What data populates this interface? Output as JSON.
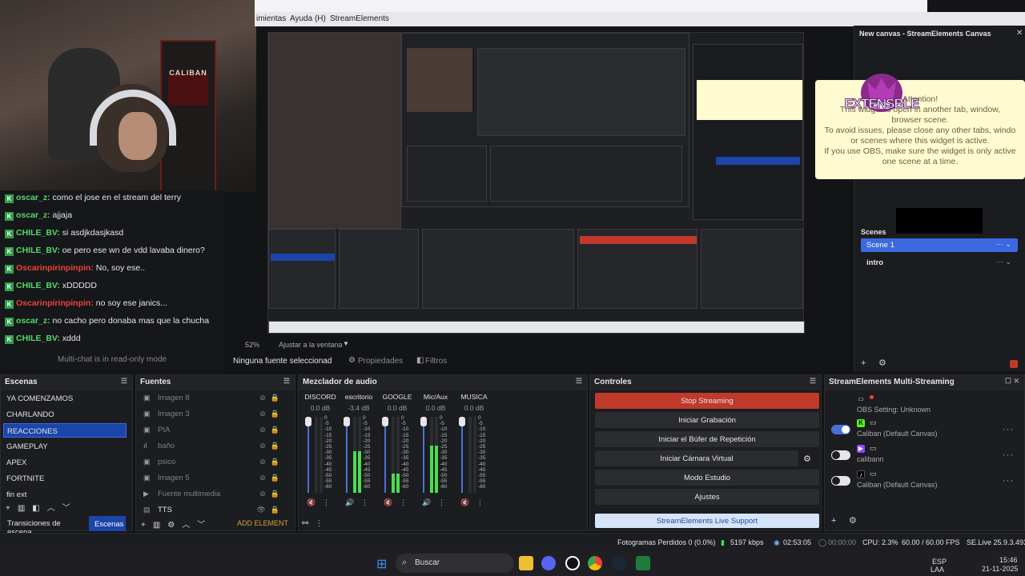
{
  "chat": {
    "lines": [
      {
        "user": "oscar_z:",
        "msg": "como el jose en el stream del terry"
      },
      {
        "user": "oscar_z:",
        "msg": "ajjaja"
      },
      {
        "user": "CHILE_BV:",
        "msg": "si asdjkdasjkasd"
      },
      {
        "user": "CHILE_BV:",
        "msg": "oe pero ese wn de vdd lavaba dinero?"
      },
      {
        "user": "Oscarinpirinpinpin:",
        "msg": "No, soy ese.."
      },
      {
        "user": "CHILE_BV:",
        "msg": "xDDDDD"
      },
      {
        "user": "Oscarinpirinpinpin:",
        "msg": "no soy ese janics..."
      },
      {
        "user": "oscar_z:",
        "msg": "no cacho pero donaba mas que la chucha"
      },
      {
        "user": "CHILE_BV:",
        "msg": "xddd"
      }
    ],
    "readonly_notice": "Multi-chat is in read-only mode",
    "badge": "K"
  },
  "webcam": {
    "arcade_text": "CALIBAN"
  },
  "menu": {
    "item1": "imientas",
    "item2": "Ayuda (H)",
    "item3": "StreamElements"
  },
  "preview": {
    "zoom": "52%",
    "fit": "Ajustar a la ventana",
    "no_source": "Ninguna fuente seleccionad",
    "properties": "Propiedades",
    "filters": "Filtros"
  },
  "right_dock": {
    "title": "New canvas - StreamElements Canvas",
    "alert_lines": [
      "Attention!",
      "This widget is open in another tab, window,",
      "browser scene.",
      "To avoid issues, please close any other tabs, windo",
      "or scenes where this widget is active.",
      "If you use OBS, make sure the widget is only active",
      "one scene at a time."
    ],
    "logo_text": "EXTENSBLE",
    "scenes_label": "Scenes",
    "scene_items": [
      "Scene 1",
      "intro"
    ]
  },
  "scenes_panel": {
    "title": "Escenas",
    "items": [
      "YA COMENZAMOS",
      "CHARLANDO",
      "REACCIONES",
      "GAMEPLAY",
      "APEX",
      "FORTNITE",
      "fin ext"
    ],
    "selected_index": 2,
    "transitions_tab": "Transiciones de escena",
    "scenes_tab": "Escenas"
  },
  "sources_panel": {
    "title": "Fuentes",
    "items": [
      "Imagen 8",
      "Imagen 3",
      "PIA",
      "baño",
      "psico",
      "Imagen 5",
      "Fuente multimedia",
      "TTS"
    ],
    "add_element": "ADD ELEMENT"
  },
  "mixer_panel": {
    "title": "Mezclador de audio",
    "channels": [
      {
        "name": "DISCORD",
        "db": "0.0 dB",
        "level": 0.0,
        "muted": true
      },
      {
        "name": "escritorio",
        "db": "-3.4 dB",
        "level": 0.55,
        "muted": false
      },
      {
        "name": "GOOGLE",
        "db": "0.0 dB",
        "level": 0.25,
        "muted": true
      },
      {
        "name": "Mic/Aux",
        "db": "0.0 dB",
        "level": 0.62,
        "muted": false
      },
      {
        "name": "MUSICA",
        "db": "0.0 dB",
        "level": 0.0,
        "muted": true
      }
    ],
    "scale": [
      "0",
      "-5",
      "-10",
      "-15",
      "-20",
      "-25",
      "-30",
      "-35",
      "-40",
      "-45",
      "-50",
      "-55",
      "-60"
    ]
  },
  "controls_panel": {
    "title": "Controles",
    "buttons": [
      "Stop Streaming",
      "Iniciar Grabación",
      "Iniciar el Búfer de Repetición",
      "Iniciar Cámara Virtual",
      "Modo Estudio",
      "Ajustes"
    ],
    "support": "StreamElements Live Support"
  },
  "sms_panel": {
    "title": "StreamElements Multi-Streaming",
    "rows": [
      {
        "name": "OBS Setting: Unknown",
        "platform": "",
        "toggle": "none"
      },
      {
        "name": "Caliban (Default Canvas)",
        "platform": "K",
        "toggle": "on",
        "color": "#53fc18"
      },
      {
        "name": "calibann",
        "platform": "▶",
        "toggle": "off",
        "color": "#9146ff"
      },
      {
        "name": "Caliban (Default Canvas)",
        "platform": "♪",
        "toggle": "off",
        "color": "#222"
      }
    ]
  },
  "status": {
    "dropped": "Fotogramas Perdidos 0 (0.0%)",
    "kbps": "5197 kbps",
    "live_time": "02:53:05",
    "rec_time": "00:00:00",
    "cpu": "CPU: 2.3%",
    "fps": "60.00 / 60.00 FPS",
    "version": "SE.Live 25.9.3.493"
  },
  "taskbar": {
    "search": "Buscar",
    "lang1": "ESP",
    "lang2": "LAA",
    "time": "15:46",
    "date": "21-11-2025"
  },
  "colors": {
    "accent": "#1b45a8",
    "stop": "#c0392b",
    "alert_bg": "#fffbd0"
  }
}
